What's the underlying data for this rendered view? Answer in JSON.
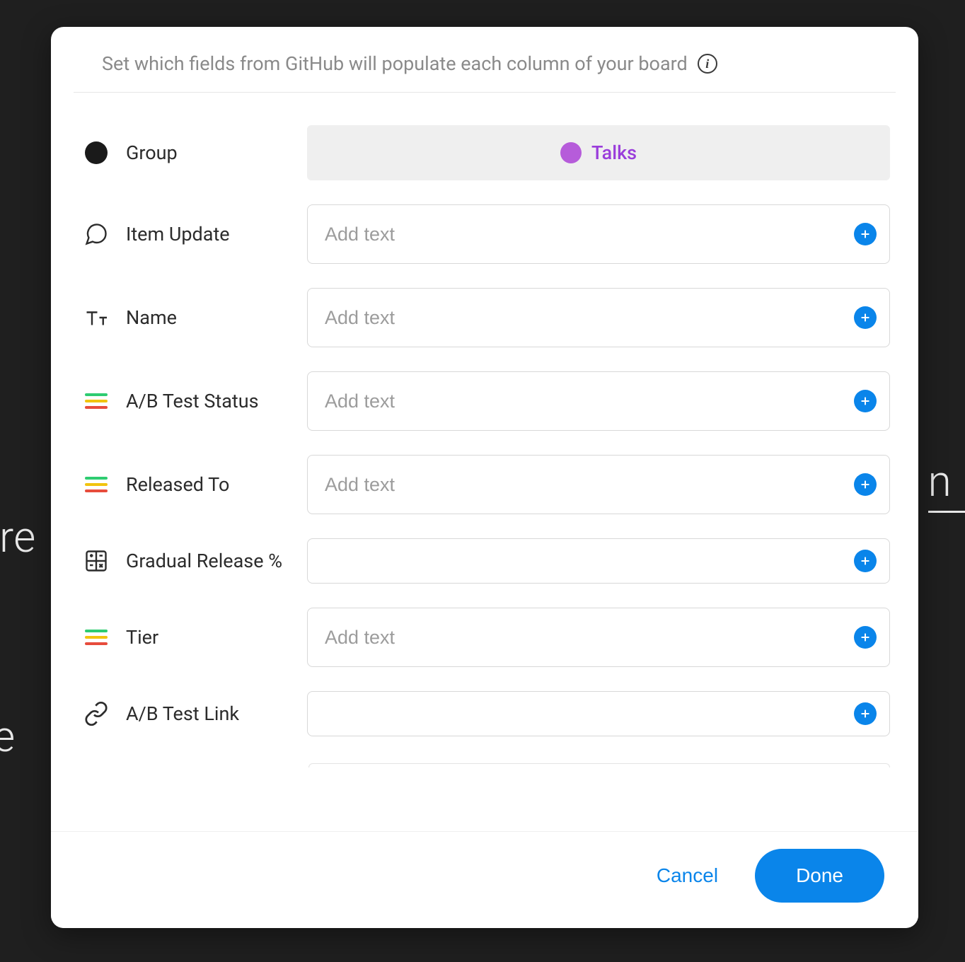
{
  "header": {
    "description": "Set which fields from GitHub will populate each column of your board"
  },
  "group": {
    "label": "Group",
    "selected_name": "Talks",
    "selected_color": "#b65cda"
  },
  "fields": [
    {
      "icon": "speech",
      "label": "Item Update",
      "placeholder": "Add text",
      "type": "text"
    },
    {
      "icon": "tt",
      "label": "Name",
      "placeholder": "Add text",
      "type": "text"
    },
    {
      "icon": "colorlines",
      "label": "A/B Test Status",
      "placeholder": "Add text",
      "type": "text"
    },
    {
      "icon": "colorlines",
      "label": "Released To",
      "placeholder": "Add text",
      "type": "text"
    },
    {
      "icon": "calc",
      "label": "Gradual Release %",
      "placeholder": "",
      "type": "short"
    },
    {
      "icon": "colorlines",
      "label": "Tier",
      "placeholder": "Add text",
      "type": "text"
    },
    {
      "icon": "link",
      "label": "A/B Test Link",
      "placeholder": "",
      "type": "short"
    }
  ],
  "footer": {
    "cancel": "Cancel",
    "done": "Done"
  },
  "background": {
    "left_line1": "l re",
    "left_line2": "re",
    "right_line1": "n it"
  }
}
